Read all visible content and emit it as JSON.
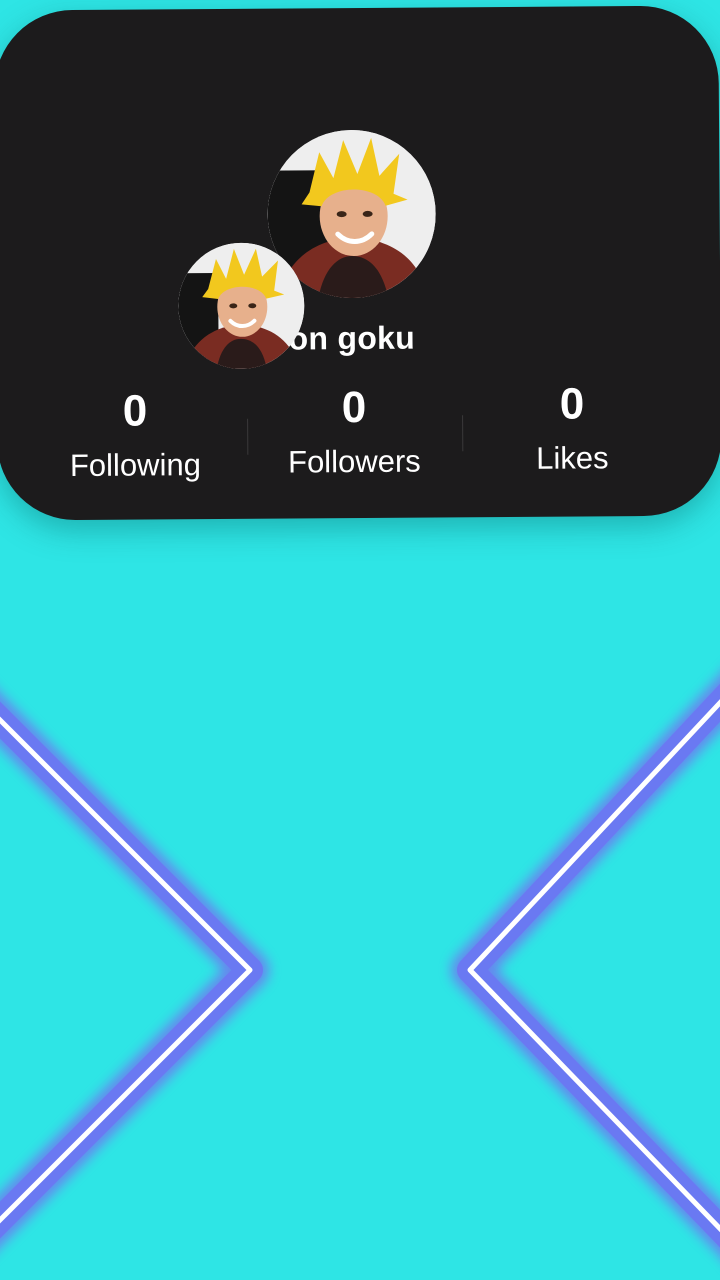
{
  "profile": {
    "username": "on goku",
    "avatar_large": "profile-photo",
    "avatar_small": "profile-photo"
  },
  "stats": {
    "following": {
      "value": "0",
      "label": "Following"
    },
    "followers": {
      "value": "0",
      "label": "Followers"
    },
    "likes": {
      "value": "0",
      "label": "Likes"
    }
  },
  "colors": {
    "background": "#2ee5e5",
    "card": "#1c1b1c",
    "line_glow": "#6d7cf0",
    "line_core": "#ffffff",
    "text": "#ffffff"
  }
}
